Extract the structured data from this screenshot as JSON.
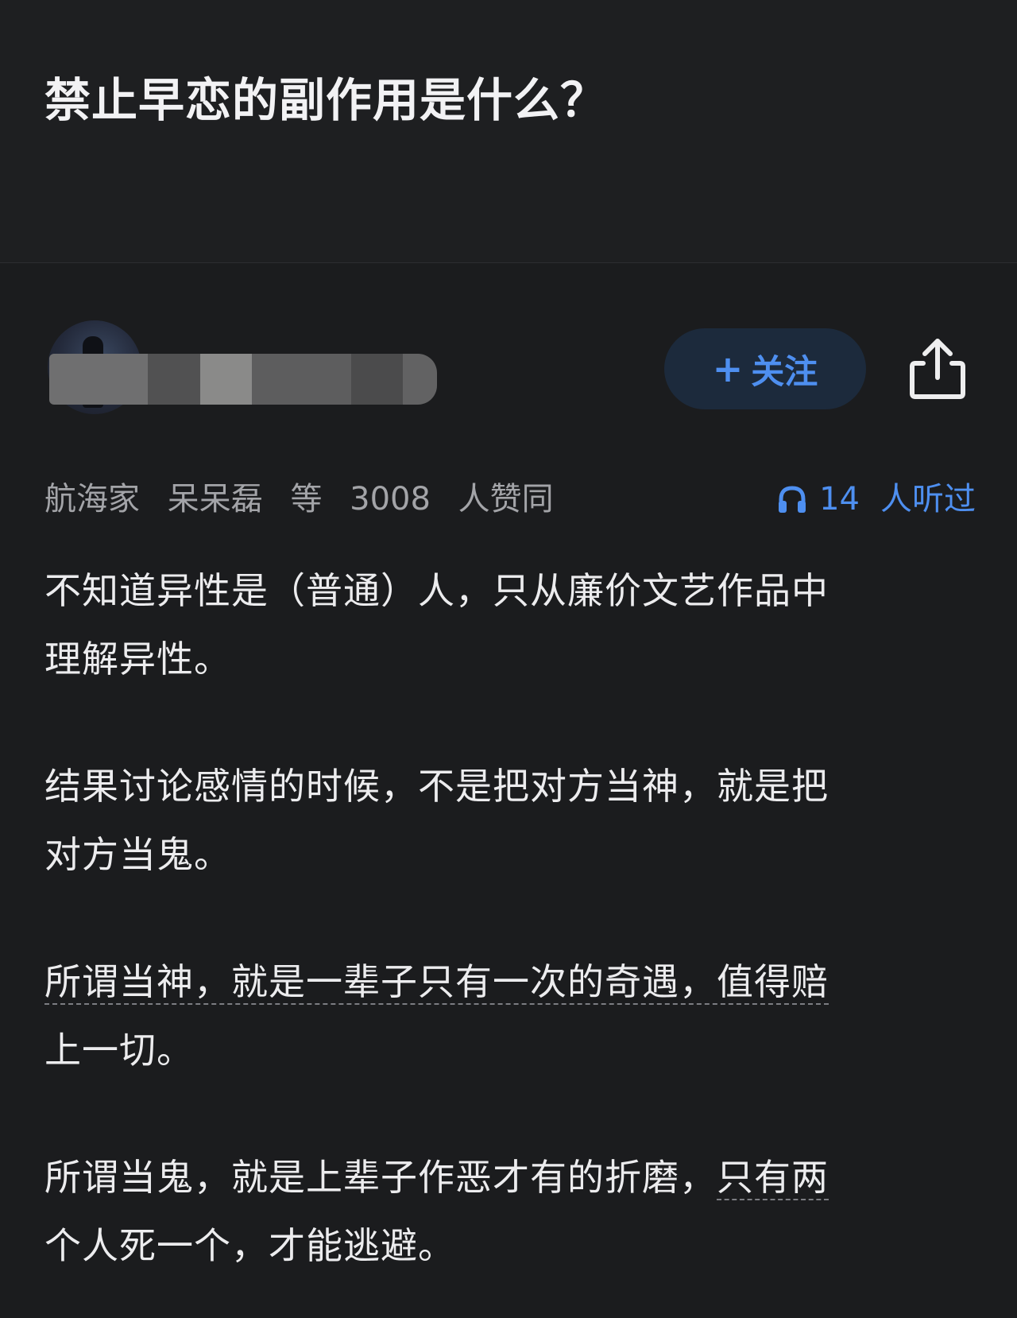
{
  "question": {
    "title": "禁止早恋的副作用是什么？"
  },
  "author": {
    "follow_label": "关注",
    "follow_icon": "plus-icon",
    "share_icon": "share-icon"
  },
  "stats": {
    "voters": [
      "航海家",
      "呆呆磊",
      "等",
      "3008",
      "人赞同"
    ],
    "listen_icon": "headphones-icon",
    "listen_count": "14",
    "listen_unit": "人听过"
  },
  "answer": {
    "p1_line1": "不知道异性是（普通）人，只从廉价文艺作品中",
    "p1_line2": "理解异性。",
    "p2_line1": "结果讨论感情的时候，不是把对方当神，就是把",
    "p2_line2": "对方当鬼。",
    "p3_line1": "所谓当神，就是一辈子只有一次的奇遇，值得赔",
    "p3_line2": "上一切。",
    "p4_line1_a": "所谓当鬼，就是上辈子作恶才有的折磨，",
    "p4_line1_b": "只有两",
    "p4_line2": "个人死一个，才能逃避。"
  },
  "colors": {
    "background": "#1b1c1e",
    "accent": "#4e8ff0",
    "muted_text": "#a3a4a8"
  }
}
